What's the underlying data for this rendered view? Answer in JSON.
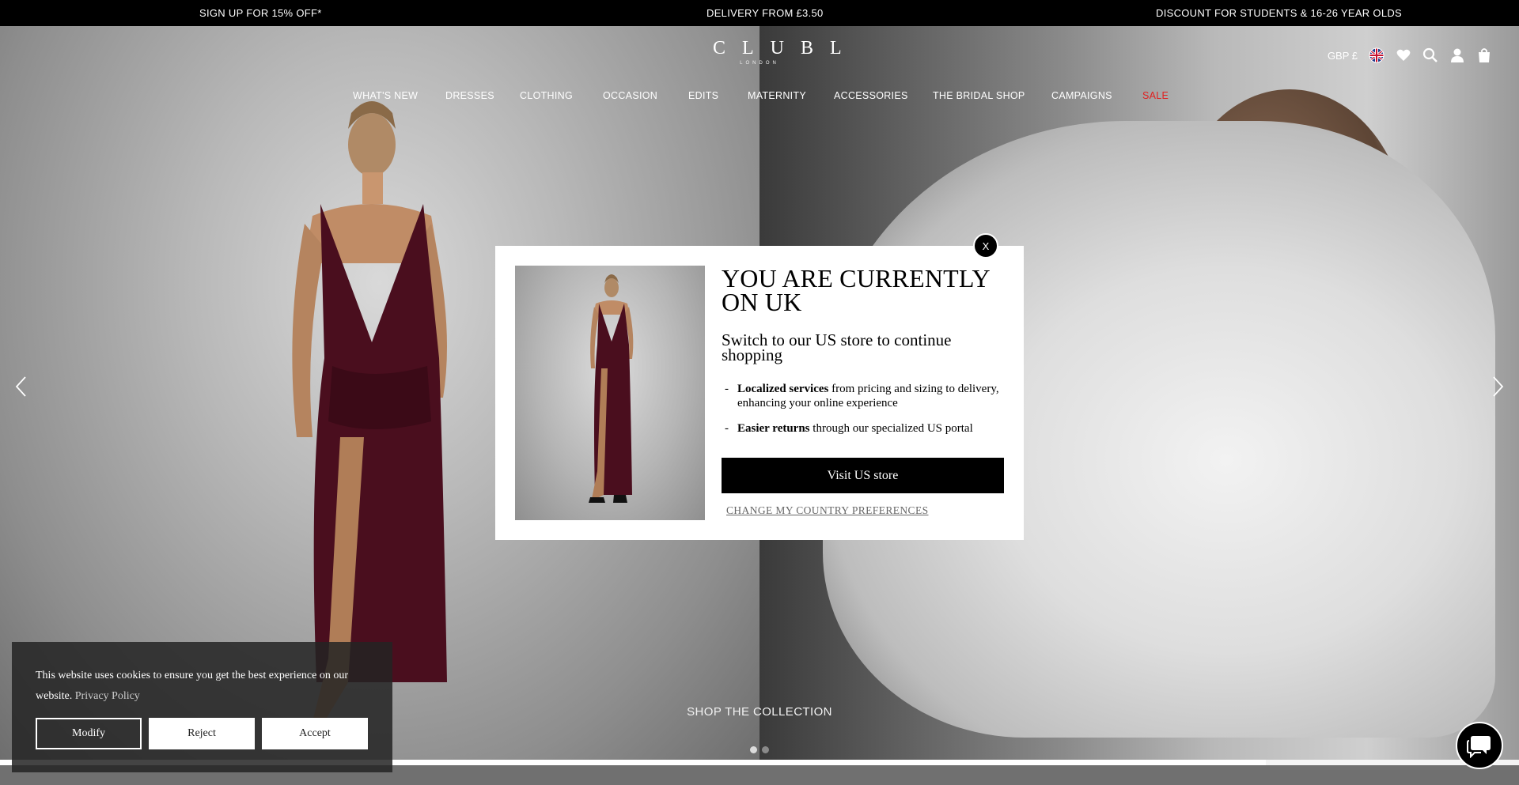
{
  "announcement": {
    "left": "SIGN UP FOR 15% OFF*",
    "center": "DELIVERY FROM £3.50",
    "right": "DISCOUNT FOR STUDENTS & 16-26 YEAR OLDS"
  },
  "header": {
    "logo_text": "CLUBL",
    "logo_sub": "LONDON",
    "currency": "GBP £",
    "icons": [
      "uk-flag-icon",
      "heart-icon",
      "search-icon",
      "account-icon",
      "bag-icon"
    ]
  },
  "nav": {
    "items": [
      "WHAT'S NEW",
      "DRESSES",
      "CLOTHING",
      "OCCASION",
      "EDITS",
      "MATERNITY",
      "ACCESSORIES",
      "THE BRIDAL SHOP",
      "CAMPAIGNS",
      "SALE"
    ],
    "sale_color": "#e02020"
  },
  "hero": {
    "shop_link": "SHOP THE COLLECTION",
    "slides": 2,
    "active_slide": 1
  },
  "modal": {
    "close": "X",
    "title": "YOU ARE CURRENTLY ON UK",
    "subtitle": "Switch to our US store to continue shopping",
    "bullets": [
      {
        "bold": "Localized services",
        "rest": " from pricing and sizing to delivery, enhancing your online experience"
      },
      {
        "bold": "Easier returns",
        "rest": " through our specialized US portal"
      }
    ],
    "visit_button": "Visit US store",
    "change_link": "CHANGE MY COUNTRY PREFERENCES"
  },
  "cookie": {
    "text": "This website uses cookies to ensure you get the best experience on our website.",
    "link": "Privacy Policy",
    "modify": "Modify",
    "reject": "Reject",
    "accept": "Accept"
  },
  "colors": {
    "dress": "#4a0e1e",
    "accent_black": "#000000",
    "sale_red": "#e02020"
  }
}
